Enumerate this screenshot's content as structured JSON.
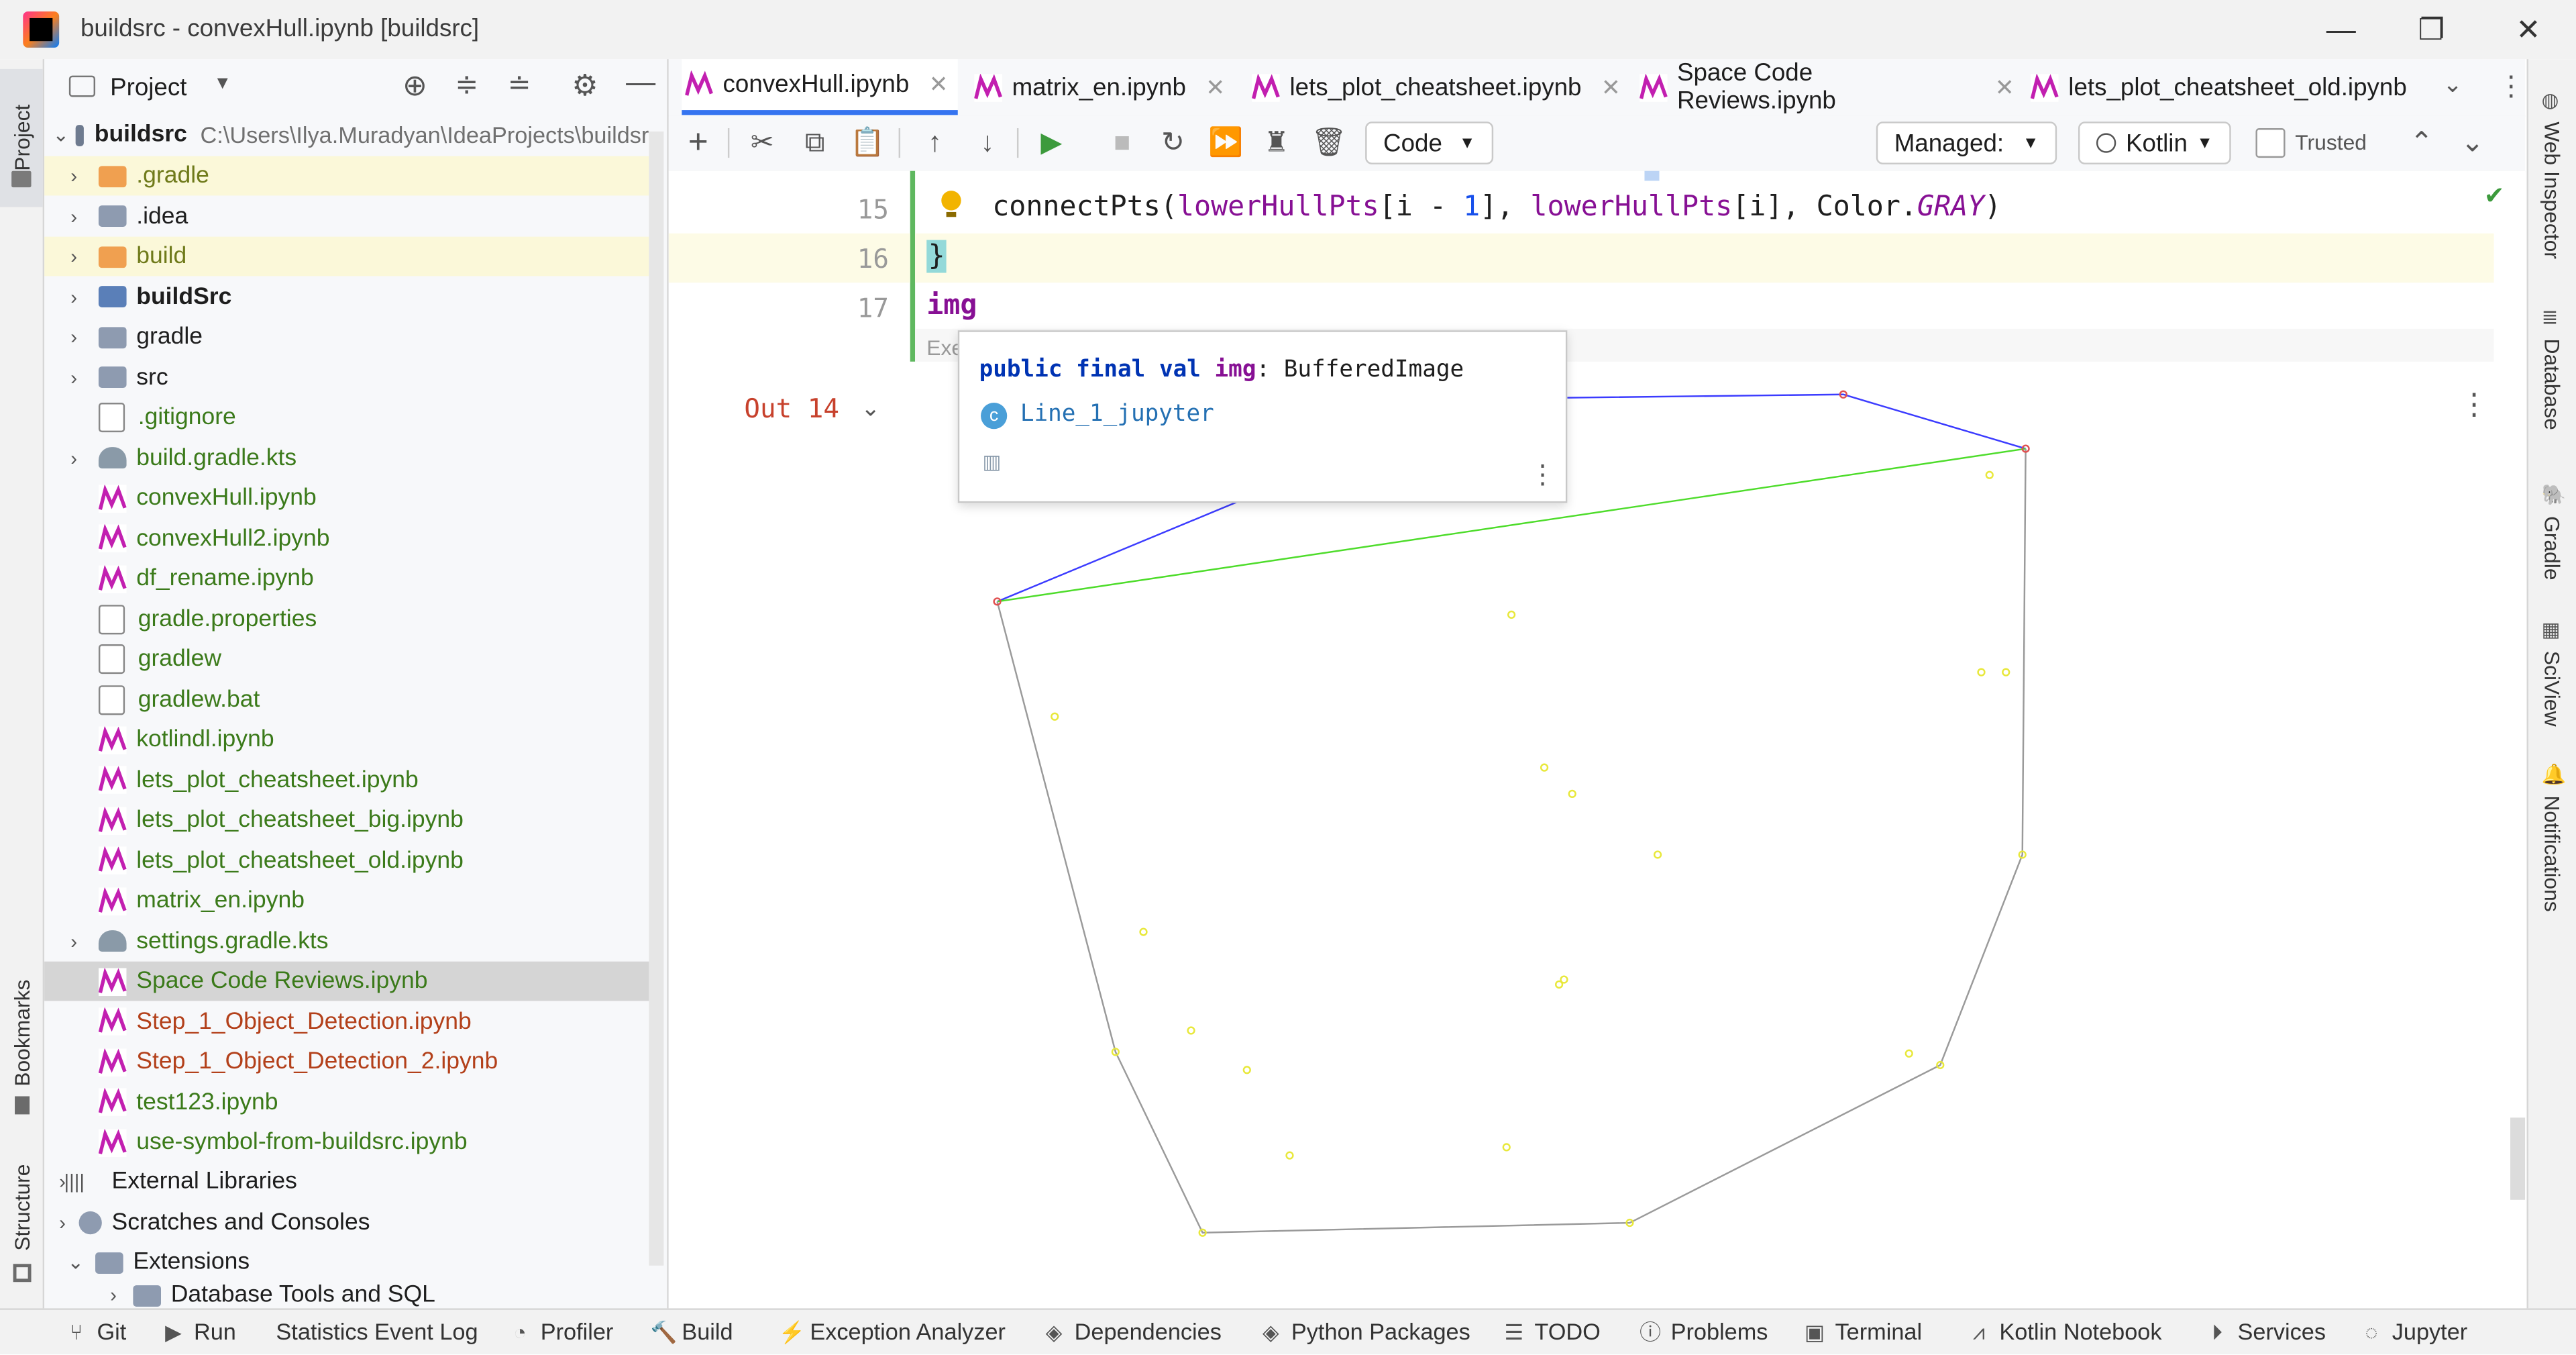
{
  "window": {
    "title": "buildsrc - convexHull.ipynb [buildsrc]",
    "minimize": "—",
    "restore": "❐",
    "close": "✕"
  },
  "left_stripe": {
    "project": "Project",
    "bookmarks": "Bookmarks",
    "structure": "Structure"
  },
  "project_panel": {
    "title": "Project",
    "root": {
      "name": "buildsrc",
      "path": "C:\\Users\\Ilya.Muradyan\\IdeaProjects\\buildsr"
    },
    "items": [
      {
        "label": ".gradle",
        "kind": "folder-orange",
        "color": "#6f7a1a",
        "chev": "›",
        "hl": true
      },
      {
        "label": ".idea",
        "kind": "folder",
        "color": "#1e1e1e",
        "chev": "›"
      },
      {
        "label": "build",
        "kind": "folder-orange",
        "color": "#6f7a1a",
        "chev": "›",
        "hl": true
      },
      {
        "label": "buildSrc",
        "kind": "folder-blue",
        "color": "#1e1e1e",
        "chev": "›",
        "bold": true
      },
      {
        "label": "gradle",
        "kind": "folder",
        "color": "#1e1e1e",
        "chev": "›"
      },
      {
        "label": "src",
        "kind": "folder",
        "color": "#1e1e1e",
        "chev": "›"
      },
      {
        "label": ".gitignore",
        "kind": "file",
        "color": "#3b7a1a"
      },
      {
        "label": "build.gradle.kts",
        "kind": "gradle",
        "color": "#3b7a1a",
        "chev": "›"
      },
      {
        "label": "convexHull.ipynb",
        "kind": "nb",
        "color": "#3b7a1a"
      },
      {
        "label": "convexHull2.ipynb",
        "kind": "nb",
        "color": "#3b7a1a"
      },
      {
        "label": "df_rename.ipynb",
        "kind": "nb",
        "color": "#3b7a1a"
      },
      {
        "label": "gradle.properties",
        "kind": "file",
        "color": "#3b7a1a"
      },
      {
        "label": "gradlew",
        "kind": "file",
        "color": "#3b7a1a"
      },
      {
        "label": "gradlew.bat",
        "kind": "file",
        "color": "#3b7a1a"
      },
      {
        "label": "kotlindl.ipynb",
        "kind": "nb",
        "color": "#3b7a1a"
      },
      {
        "label": "lets_plot_cheatsheet.ipynb",
        "kind": "nb",
        "color": "#3b7a1a"
      },
      {
        "label": "lets_plot_cheatsheet_big.ipynb",
        "kind": "nb",
        "color": "#3b7a1a"
      },
      {
        "label": "lets_plot_cheatsheet_old.ipynb",
        "kind": "nb",
        "color": "#3b7a1a"
      },
      {
        "label": "matrix_en.ipynb",
        "kind": "nb",
        "color": "#3b7a1a"
      },
      {
        "label": "settings.gradle.kts",
        "kind": "gradle",
        "color": "#3b7a1a",
        "chev": "›"
      },
      {
        "label": "Space Code Reviews.ipynb",
        "kind": "nb",
        "color": "#3b7a1a",
        "selected": true
      },
      {
        "label": "Step_1_Object_Detection.ipynb",
        "kind": "nb",
        "color": "#b3401a"
      },
      {
        "label": "Step_1_Object_Detection_2.ipynb",
        "kind": "nb",
        "color": "#b3401a"
      },
      {
        "label": "test123.ipynb",
        "kind": "nb",
        "color": "#3b7a1a"
      },
      {
        "label": "use-symbol-from-buildsrc.ipynb",
        "kind": "nb",
        "color": "#3b7a1a"
      }
    ],
    "external_libraries": "External Libraries",
    "scratches": "Scratches and Consoles",
    "extensions": "Extensions",
    "db_tools": "Database Tools and SQL"
  },
  "tabs": [
    {
      "label": "convexHull.ipynb",
      "active": true
    },
    {
      "label": "matrix_en.ipynb"
    },
    {
      "label": "lets_plot_cheatsheet.ipynb"
    },
    {
      "label": "Space Code Reviews.ipynb"
    },
    {
      "label": "lets_plot_cheatsheet_old.ipynb"
    }
  ],
  "toolbar": {
    "cell_type": "Code",
    "managed": "Managed:",
    "kernel": "Kotlin",
    "trusted": "Trusted"
  },
  "editor": {
    "lines": [
      {
        "num": "15",
        "code_fn": "connectPts(",
        "arg1": "lowerHullPts",
        "mid1": "[i - ",
        "one": "1",
        "mid2": "], ",
        "arg2": "lowerHullPts",
        "mid3": "[i], Color.",
        "const": "GRAY",
        "end": ")"
      },
      {
        "num": "16",
        "code": "}"
      },
      {
        "num": "17",
        "code": "img"
      }
    ],
    "exec_label": "Exe",
    "out_label": "Out 14",
    "popup": {
      "kw": "public final val",
      "name": "img",
      "type": ": BufferedImage",
      "source": "Line_1_jupyter"
    }
  },
  "right_stripe": [
    "Web Inspector",
    "Database",
    "Gradle",
    "SciView",
    "Notifications"
  ],
  "status_bar": [
    {
      "label": "Git",
      "icon": "git-icon"
    },
    {
      "label": "Run",
      "icon": "run-icon"
    },
    {
      "label": "Statistics Event Log",
      "icon": ""
    },
    {
      "label": "Profiler",
      "icon": "profiler-icon"
    },
    {
      "label": "Build",
      "icon": "build-icon"
    },
    {
      "label": "Exception Analyzer",
      "icon": "bolt-icon"
    },
    {
      "label": "Dependencies",
      "icon": "layers-icon"
    },
    {
      "label": "Python Packages",
      "icon": "layers-icon"
    },
    {
      "label": "TODO",
      "icon": "list-icon"
    },
    {
      "label": "Problems",
      "icon": "info-icon"
    },
    {
      "label": "Terminal",
      "icon": "terminal-icon"
    },
    {
      "label": "Kotlin Notebook",
      "icon": "notebook-icon"
    },
    {
      "label": "Services",
      "icon": "services-icon"
    },
    {
      "label": "Jupyter",
      "icon": "jupyter-icon"
    }
  ]
}
